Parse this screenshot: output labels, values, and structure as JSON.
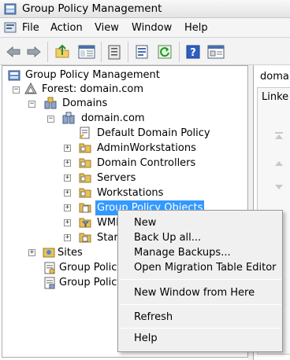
{
  "window": {
    "title": "Group Policy Management"
  },
  "menubar": {
    "items": [
      "File",
      "Action",
      "View",
      "Window",
      "Help"
    ]
  },
  "toolbar": {
    "buttons": [
      {
        "icon": "back-arrow-icon"
      },
      {
        "icon": "forward-arrow-icon"
      },
      {
        "icon": "up-folder-icon"
      },
      {
        "icon": "show-hide-tree-icon"
      },
      {
        "icon": "clipboard-icon"
      },
      {
        "icon": "export-list-icon"
      },
      {
        "icon": "refresh-icon"
      },
      {
        "icon": "help-icon"
      },
      {
        "icon": "properties-icon"
      }
    ]
  },
  "tree": {
    "root": "Group Policy Management",
    "forest": "Forest: domain.com",
    "domains": "Domains",
    "domain": "domain.com",
    "items": {
      "default_domain_policy": "Default Domain Policy",
      "admin_workstations": "AdminWorkstations",
      "domain_controllers": "Domain Controllers",
      "servers": "Servers",
      "workstations": "Workstations",
      "group_policy_objects": "Group Policy Objects",
      "wmi": "WMI",
      "starter": "Start",
      "sites": "Sites",
      "gp_modeling": "Group Policy",
      "gp_results": "Group Policy"
    },
    "selected": "Group Policy Objects"
  },
  "right_pane": {
    "header": "domai",
    "tab": "Linke"
  },
  "context_menu": {
    "items": [
      "New",
      "Back Up all...",
      "Manage Backups...",
      "Open Migration Table Editor",
      "New Window from Here",
      "Refresh",
      "Help"
    ]
  },
  "colors": {
    "selection": "#3399ff",
    "folder": "#e8c15a",
    "menu_bg": "#f0f0f0"
  }
}
